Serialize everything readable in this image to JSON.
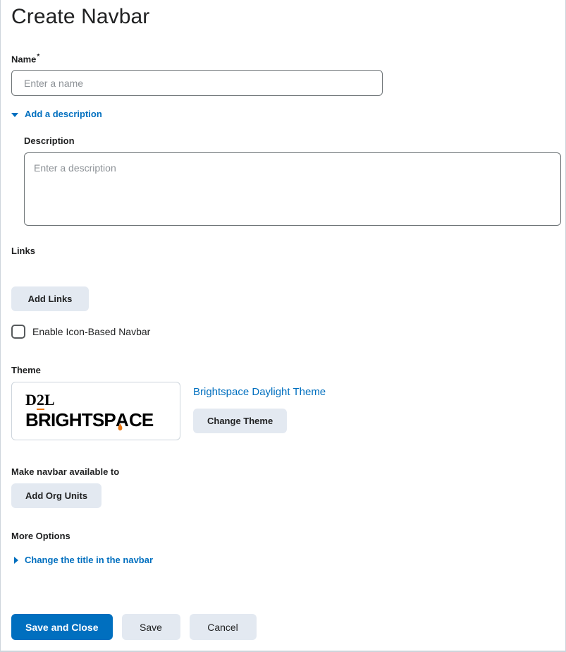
{
  "page": {
    "title": "Create Navbar"
  },
  "name_field": {
    "label": "Name",
    "required_marker": "*",
    "placeholder": "Enter a name",
    "value": ""
  },
  "description_disclosure": {
    "label": "Add a description",
    "icon": "triangle-down-icon",
    "expanded": true
  },
  "description_field": {
    "label": "Description",
    "placeholder": "Enter a description",
    "value": ""
  },
  "links_section": {
    "label": "Links",
    "add_links_label": "Add Links",
    "icon_navbar_checkbox_label": "Enable Icon-Based Navbar",
    "icon_navbar_checked": false
  },
  "theme_section": {
    "label": "Theme",
    "logo_primary": "D2L",
    "logo_secondary": "BRIGHTSPACE",
    "theme_name": "Brightspace Daylight Theme",
    "change_theme_label": "Change Theme"
  },
  "org_section": {
    "label": "Make navbar available to",
    "add_org_units_label": "Add Org Units"
  },
  "more_options": {
    "label": "More Options",
    "change_title_label": "Change the title in the navbar",
    "icon": "triangle-right-icon",
    "expanded": false
  },
  "footer": {
    "save_and_close_label": "Save and Close",
    "save_label": "Save",
    "cancel_label": "Cancel"
  },
  "colors": {
    "accent_blue": "#006fbf",
    "secondary_button_bg": "#e3e9f1",
    "border_gray": "#cdd5dc",
    "input_border": "#6e7477",
    "placeholder": "#8c9196",
    "text": "#202122",
    "flame_orange": "#e87511"
  }
}
